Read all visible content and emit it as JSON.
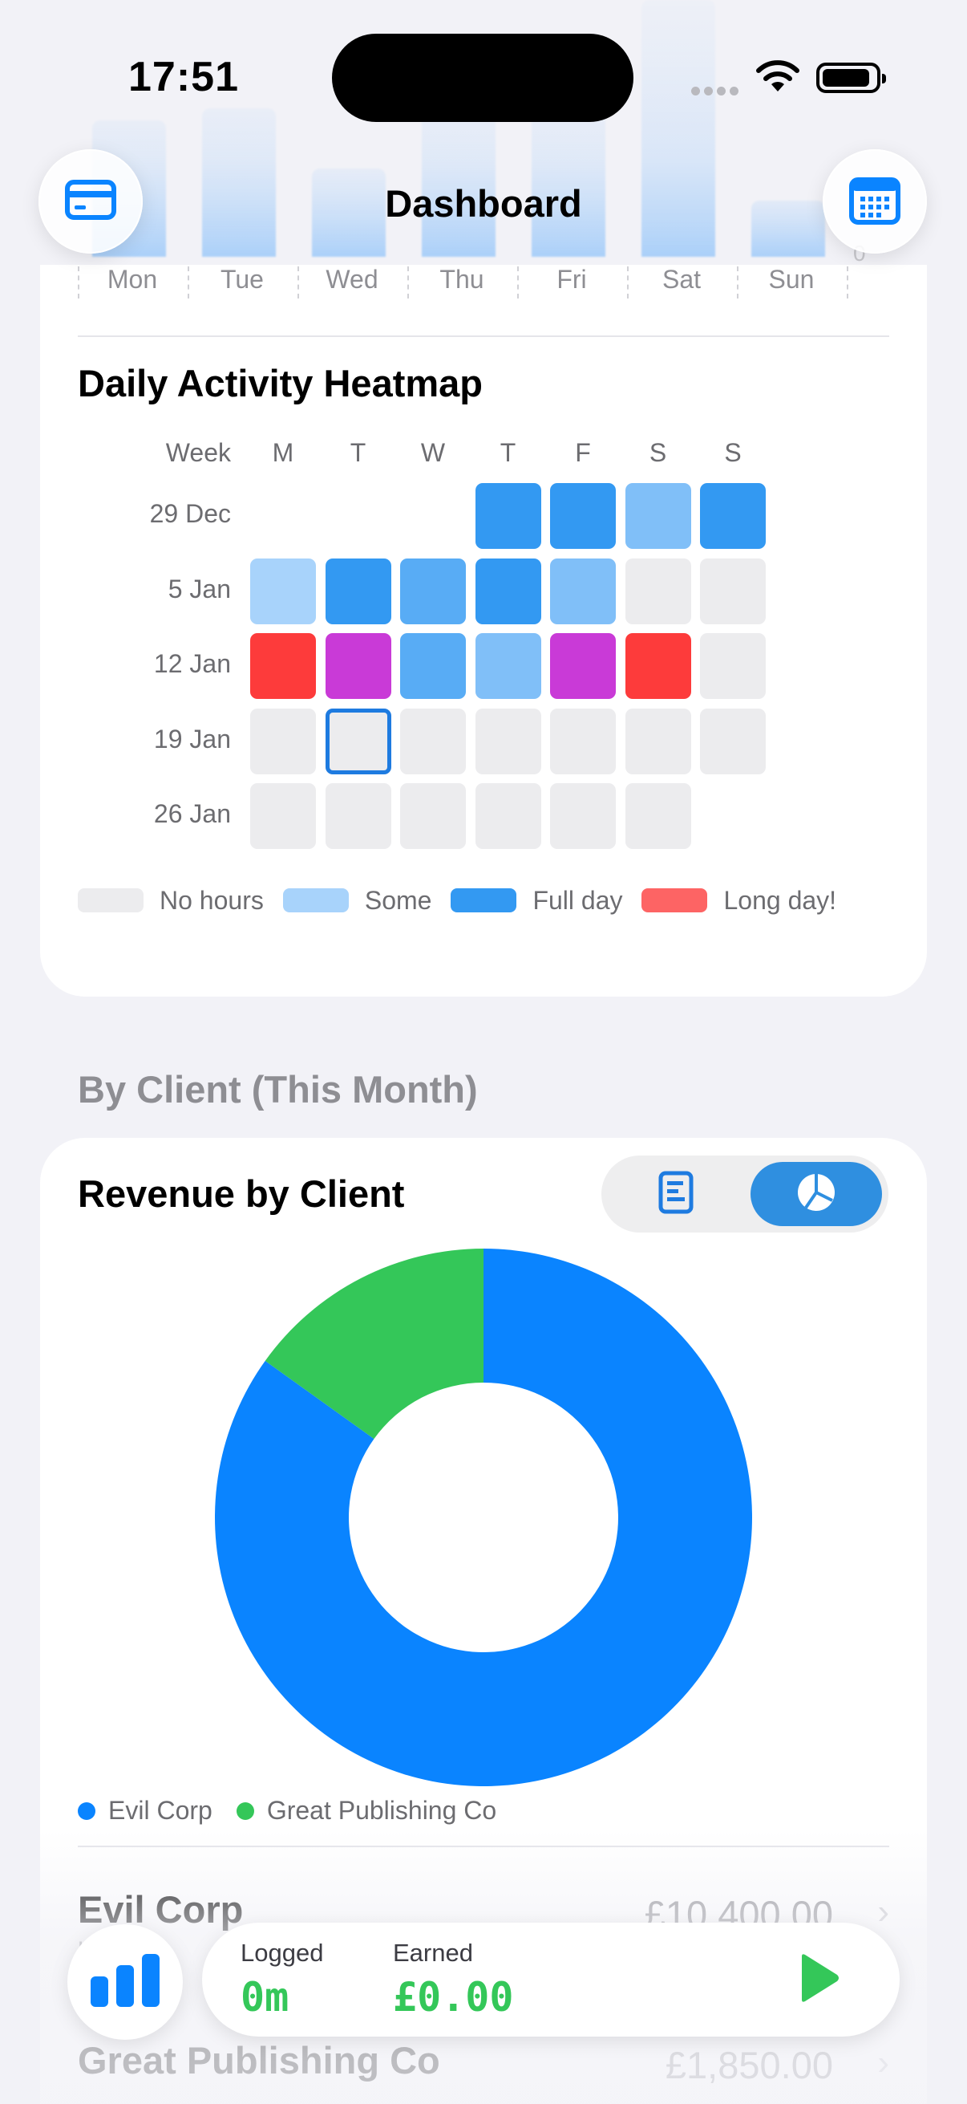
{
  "status": {
    "time": "17:51"
  },
  "nav": {
    "title": "Dashboard",
    "left_icon": "credit-card-icon",
    "right_icon": "calendar-icon"
  },
  "week_axis": {
    "days": [
      "Mon",
      "Tue",
      "Wed",
      "Thu",
      "Fri",
      "Sat",
      "Sun"
    ],
    "zero_label": "0"
  },
  "heatmap": {
    "title": "Daily Activity Heatmap",
    "week_header": "Week",
    "columns": [
      "M",
      "T",
      "W",
      "T",
      "F",
      "S",
      "S"
    ],
    "rows": [
      {
        "label": "29 Dec",
        "cells": [
          "none-hidden",
          "none-hidden",
          "none-hidden",
          "full",
          "full",
          "some",
          "full"
        ]
      },
      {
        "label": "5 Jan",
        "cells": [
          "light",
          "full",
          "mid",
          "full",
          "some",
          "none",
          "none"
        ]
      },
      {
        "label": "12 Jan",
        "cells": [
          "long",
          "purple",
          "mid",
          "some",
          "purple",
          "long",
          "none"
        ]
      },
      {
        "label": "19 Jan",
        "cells": [
          "none",
          "today",
          "none",
          "none",
          "none",
          "none",
          "none"
        ]
      },
      {
        "label": "26 Jan",
        "cells": [
          "none",
          "none",
          "none",
          "none",
          "none",
          "none",
          "none-hidden"
        ]
      }
    ],
    "colors": {
      "none": "#ececee",
      "light": "#a8d3fb",
      "some": "#80bff8",
      "mid": "#58acf5",
      "full": "#3399f2",
      "long": "#fd3b3b",
      "purple": "#c93ad7"
    },
    "legend": [
      {
        "label": "No hours",
        "color": "#ececee"
      },
      {
        "label": "Some",
        "color": "#a8d3fb"
      },
      {
        "label": "Full day",
        "color": "#3399f2"
      },
      {
        "label": "Long day!",
        "color": "#fd6464"
      }
    ]
  },
  "section": {
    "by_client": "By Client (This Month)"
  },
  "revenue": {
    "title": "Revenue by Client",
    "toggle": {
      "list_icon": "list-icon",
      "pie_icon": "pie-chart-icon",
      "selected": "pie"
    }
  },
  "chart_data": {
    "type": "pie",
    "title": "Revenue by Client",
    "series": [
      {
        "name": "Evil Corp",
        "value": 10400,
        "color": "#0a84ff"
      },
      {
        "name": "Great Publishing Co",
        "value": 1850,
        "color": "#34c759"
      }
    ]
  },
  "clients": [
    {
      "name": "Evil Corp",
      "sub": "h",
      "amount": "£10,400.00"
    },
    {
      "name": "Great Publishing Co",
      "sub": "",
      "amount": "£1,850.00"
    }
  ],
  "timer": {
    "logged_label": "Logged",
    "logged_value": "0m",
    "earned_label": "Earned",
    "earned_value": "£0.00"
  }
}
